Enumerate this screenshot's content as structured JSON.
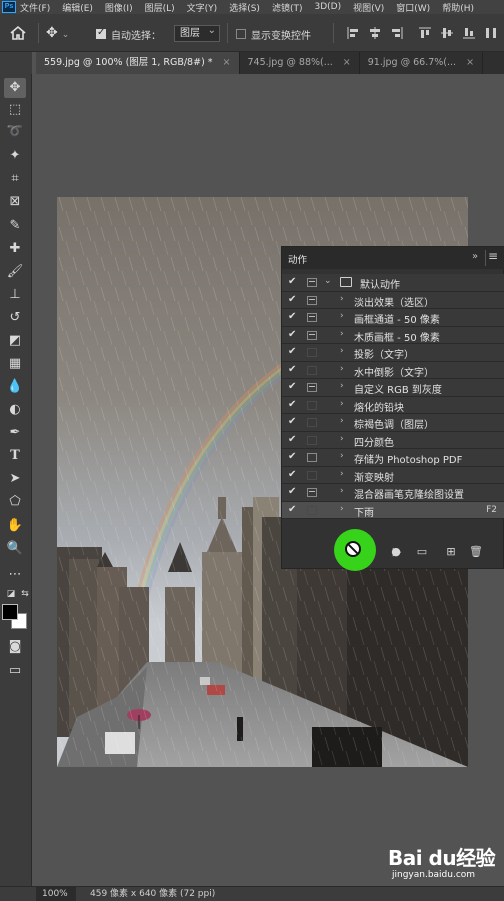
{
  "app": {
    "logo": "Ps"
  },
  "menubar": {
    "items": [
      "文件(F)",
      "编辑(E)",
      "图像(I)",
      "图层(L)",
      "文字(Y)",
      "选择(S)",
      "滤镜(T)",
      "3D(D)",
      "视图(V)",
      "窗口(W)",
      "帮助(H)"
    ]
  },
  "options": {
    "auto_select_label": "自动选择：",
    "auto_select_checked": true,
    "auto_select_value": "图层",
    "show_transform_label": "显示变换控件",
    "show_transform_checked": false
  },
  "tabs": [
    {
      "label": "559.jpg @ 100% (图层 1, RGB/8#) *",
      "active": true,
      "close": "×"
    },
    {
      "label": "745.jpg @ 88%(...",
      "active": false,
      "close": "×"
    },
    {
      "label": "91.jpg @ 66.7%(...",
      "active": false,
      "close": "×"
    }
  ],
  "actions_panel": {
    "title": "动作",
    "collapse": "»",
    "set": {
      "name": "默认动作",
      "checked": true
    },
    "actions": [
      {
        "name": "淡出效果（选区）",
        "checked": true,
        "dialog": true
      },
      {
        "name": "画框通道 - 50 像素",
        "checked": true,
        "dialog": true
      },
      {
        "name": "木质画框 - 50 像素",
        "checked": true,
        "dialog": true
      },
      {
        "name": "投影（文字）",
        "checked": true,
        "dialog": false
      },
      {
        "name": "水中倒影（文字）",
        "checked": true,
        "dialog": false
      },
      {
        "name": "自定义 RGB 到灰度",
        "checked": true,
        "dialog": true
      },
      {
        "name": "熔化的铅块",
        "checked": true,
        "dialog": false
      },
      {
        "name": "棕褐色调（图层）",
        "checked": true,
        "dialog": false
      },
      {
        "name": "四分颜色",
        "checked": true,
        "dialog": false
      },
      {
        "name": "存储为 Photoshop PDF",
        "checked": true,
        "dialog": true
      },
      {
        "name": "渐变映射",
        "checked": true,
        "dialog": false
      },
      {
        "name": "混合器画笔克隆绘图设置",
        "checked": true,
        "dialog": true
      },
      {
        "name": "下雨",
        "checked": true,
        "dialog": false,
        "key": "F2",
        "selected": true
      }
    ]
  },
  "status": {
    "zoom": "100%",
    "dimensions": "459 像素 x 640 像素 (72 ppi)"
  },
  "watermark": {
    "brand": "Bai du经验",
    "url": "jingyan.baidu.com"
  },
  "colors": {
    "highlight": "#37d21a",
    "ps_blue": "#31a8ff"
  }
}
